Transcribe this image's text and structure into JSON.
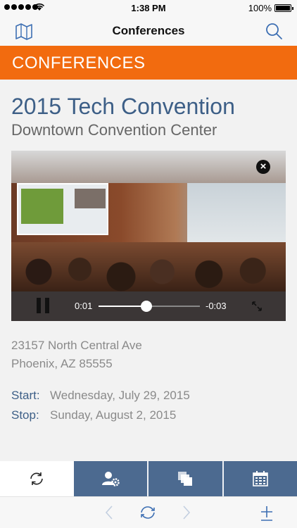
{
  "status_bar": {
    "time": "1:38 PM",
    "battery": "100%"
  },
  "nav": {
    "title": "Conferences",
    "left_icon": "map-icon",
    "right_icon": "search-icon"
  },
  "banner": {
    "label": "CONFERENCES"
  },
  "conference": {
    "title": "2015 Tech Convention",
    "venue": "Downtown Convention Center",
    "address_line1": "23157 North Central Ave",
    "address_line2": "Phoenix, AZ 85555",
    "start_label": "Start:",
    "start_value": "Wednesday, July 29, 2015",
    "stop_label": "Stop:",
    "stop_value": "Sunday, August 2, 2015"
  },
  "video": {
    "current_time": "0:01",
    "remaining_time": "-0:03",
    "progress": 0.47
  },
  "tabs": [
    {
      "icon": "refresh-icon",
      "selected": true
    },
    {
      "icon": "user-settings-icon",
      "selected": false
    },
    {
      "icon": "copy-icon",
      "selected": false
    },
    {
      "icon": "calendar-icon",
      "selected": false
    }
  ],
  "toolbar": [
    "back-icon",
    "reload-icon",
    "forward-icon",
    "add-icon"
  ],
  "colors": {
    "accent": "#f26b0f",
    "brand_blue": "#3d5f87",
    "tab_bg": "#4c6a90"
  }
}
